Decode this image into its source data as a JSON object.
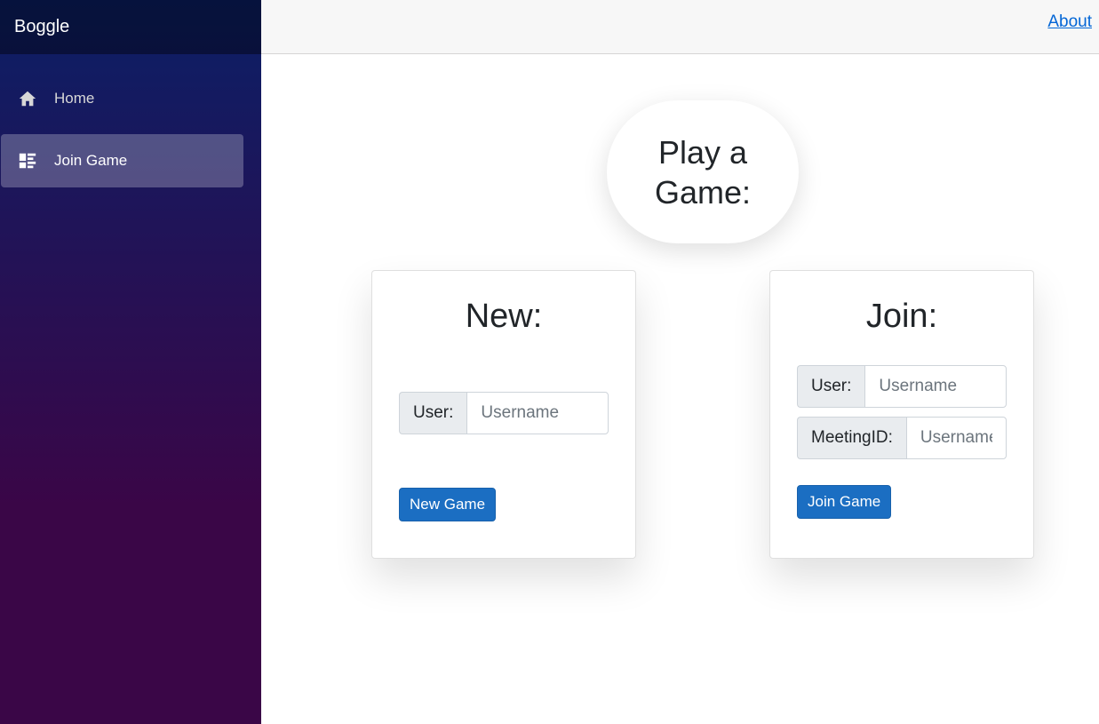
{
  "app": {
    "brand": "Boggle"
  },
  "sidebar": {
    "items": [
      {
        "label": "Home",
        "icon": "home-icon",
        "active": false
      },
      {
        "label": "Join Game",
        "icon": "dashboard-icon",
        "active": true
      }
    ]
  },
  "topbar": {
    "about_label": "About"
  },
  "main": {
    "title": "Play a Game:"
  },
  "new_card": {
    "title": "New:",
    "user_label": "User:",
    "user_placeholder": "Username",
    "button_label": "New Game"
  },
  "join_card": {
    "title": "Join:",
    "user_label": "User:",
    "user_placeholder": "Username",
    "meeting_label": "MeetingID:",
    "meeting_placeholder": "Username",
    "button_label": "Join Game"
  },
  "colors": {
    "sidebar_top": "#0b1f66",
    "sidebar_bottom": "#3a0647",
    "primary_button": "#1b6ec2",
    "link": "#0366d6"
  }
}
